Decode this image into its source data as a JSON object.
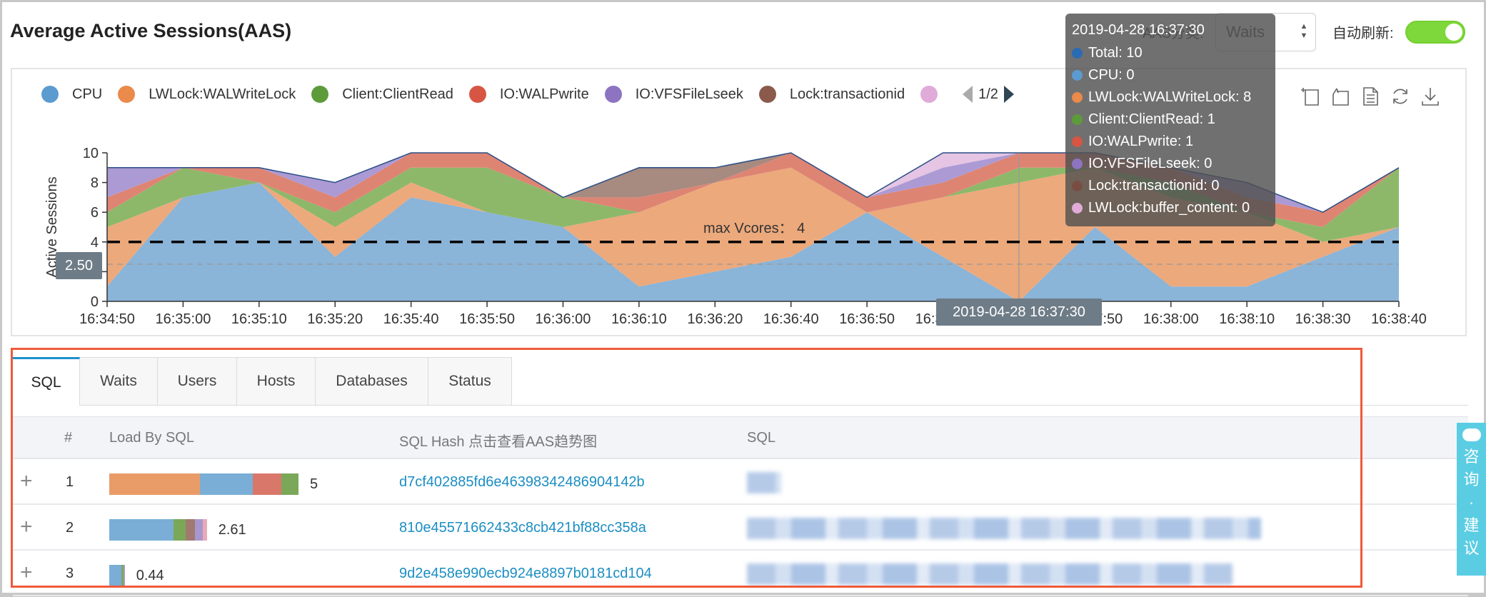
{
  "header": {
    "title": "Average Active Sessions(AAS)",
    "dimension_label": "AAS分类:",
    "dimension_select": "Waits",
    "auto_refresh_label": "自动刷新:",
    "auto_refresh_on": true
  },
  "legend": {
    "page": "1/2",
    "items": [
      {
        "label": "CPU",
        "color": "#5b9bd0"
      },
      {
        "label": "LWLock:WALWriteLock",
        "color": "#ea8a4b"
      },
      {
        "label": "Client:ClientRead",
        "color": "#5d9b3a"
      },
      {
        "label": "IO:WALPwrite",
        "color": "#d65643"
      },
      {
        "label": "IO:VFSFileLseek",
        "color": "#8d74c1"
      },
      {
        "label": "Lock:transactionid",
        "color": "#8b5a4c"
      },
      {
        "label": "",
        "color": "#e0abd8"
      }
    ]
  },
  "toolbox": [
    "zoom-icon",
    "zoom-reset-icon",
    "data-view-icon",
    "restore-icon",
    "save-image-icon"
  ],
  "chart_data": {
    "type": "area",
    "stacked": true,
    "ylabel": "Active Sessions",
    "ylim": [
      0,
      10
    ],
    "yticks": [
      0,
      2,
      4,
      6,
      8,
      10
    ],
    "x": [
      "16:34:50",
      "16:35:00",
      "16:35:10",
      "16:35:20",
      "16:35:40",
      "16:35:50",
      "16:36:00",
      "16:36:10",
      "16:36:20",
      "16:36:40",
      "16:36:50",
      "16:37:00",
      "16:37:30",
      "16:37:50",
      "16:38:00",
      "16:38:10",
      "16:38:30",
      "16:38:40"
    ],
    "series": [
      {
        "name": "CPU",
        "color": "#8ab4d8",
        "values": [
          1,
          7,
          8,
          3,
          7,
          6,
          5,
          1,
          2,
          3,
          6,
          3,
          0,
          5,
          1,
          1,
          3,
          5
        ]
      },
      {
        "name": "LWLock:WALWriteLock",
        "color": "#eca97c",
        "values": [
          4,
          0,
          0,
          2,
          1,
          0,
          0,
          5,
          6,
          6,
          0,
          4,
          8,
          4,
          6,
          5,
          1,
          0
        ]
      },
      {
        "name": "Client:ClientRead",
        "color": "#8db86a",
        "values": [
          1,
          2,
          0,
          1,
          1,
          3,
          2,
          0,
          0,
          0,
          0,
          0,
          1,
          0,
          1,
          0,
          1,
          4
        ]
      },
      {
        "name": "IO:WALPwrite",
        "color": "#de8473",
        "values": [
          1,
          0,
          1,
          1,
          1,
          1,
          0,
          1,
          0,
          1,
          1,
          1,
          1,
          1,
          1,
          1,
          1,
          0
        ]
      },
      {
        "name": "IO:VFSFileLseek",
        "color": "#ac9ad4",
        "values": [
          2,
          0,
          0,
          1,
          0,
          0,
          0,
          0,
          0,
          0,
          0,
          1,
          0,
          0,
          0,
          1,
          0,
          0
        ]
      },
      {
        "name": "Lock:transactionid",
        "color": "#a78a80",
        "values": [
          0,
          0,
          0,
          0,
          0,
          0,
          0,
          2,
          1,
          0,
          0,
          0,
          0,
          0,
          0,
          0,
          0,
          0
        ]
      },
      {
        "name": "LWLock:buffer_content",
        "color": "#e5c4e4",
        "values": [
          0,
          0,
          0,
          0,
          0,
          0,
          0,
          0,
          0,
          0,
          0,
          1,
          0,
          0,
          0,
          0,
          0,
          0
        ]
      }
    ],
    "total_line_color": "#2a4f85",
    "mark_line": {
      "value": 4,
      "label": "max Vcores： 4"
    },
    "crosshair": {
      "x": "16:37:30",
      "y": 2.5,
      "y_label": "2.50",
      "x_label": "2019-04-28 16:37:30"
    }
  },
  "tooltip": {
    "title": "2019-04-28 16:37:30",
    "rows": [
      {
        "label": "Total: 10",
        "color": "#2a6bb3"
      },
      {
        "label": "CPU: 0",
        "color": "#5b9bd0"
      },
      {
        "label": "LWLock:WALWriteLock: 8",
        "color": "#ea8a4b"
      },
      {
        "label": "Client:ClientRead: 1",
        "color": "#5d9b3a"
      },
      {
        "label": "IO:WALPwrite: 1",
        "color": "#d65643"
      },
      {
        "label": "IO:VFSFileLseek: 0",
        "color": "#8d74c1"
      },
      {
        "label": "Lock:transactionid: 0",
        "color": "#7a4d42"
      },
      {
        "label": "LWLock:buffer_content: 0",
        "color": "#e0abd8"
      }
    ]
  },
  "tabs": [
    {
      "label": "SQL",
      "active": true
    },
    {
      "label": "Waits"
    },
    {
      "label": "Users"
    },
    {
      "label": "Hosts"
    },
    {
      "label": "Databases"
    },
    {
      "label": "Status"
    }
  ],
  "table": {
    "headers": {
      "index": "#",
      "load": "Load By SQL",
      "hash": "SQL Hash 点击查看AAS趋势图",
      "sql": "SQL"
    },
    "rows": [
      {
        "index": "1",
        "load": "5",
        "hash": "d7cf402885fd6e46398342486904142b",
        "sql_blurred": true,
        "segments": [
          {
            "color": "#e99c68",
            "value": 2.4
          },
          {
            "color": "#7aaed6",
            "value": 1.4
          },
          {
            "color": "#d9776a",
            "value": 0.75
          },
          {
            "color": "#7ba858",
            "value": 0.45
          }
        ]
      },
      {
        "index": "2",
        "load": "2.61",
        "hash": "810e45571662433c8cb421bf88cc358a",
        "sql_blurred": true,
        "segments": [
          {
            "color": "#7aaed6",
            "value": 1.7
          },
          {
            "color": "#7ba858",
            "value": 0.32
          },
          {
            "color": "#a07a70",
            "value": 0.24
          },
          {
            "color": "#a897cf",
            "value": 0.22
          },
          {
            "color": "#e8a9b8",
            "value": 0.1
          }
        ]
      },
      {
        "index": "3",
        "load": "0.44",
        "hash": "9d2e458e990ecb924e8897b0181cd104",
        "sql_blurred": true,
        "segments": [
          {
            "color": "#7aaed6",
            "value": 0.33
          },
          {
            "color": "#7ba858",
            "value": 0.05
          },
          {
            "color": "#a897cf",
            "value": 0.03
          }
        ]
      }
    ]
  },
  "side_button": {
    "chars": [
      "咨",
      "询",
      "·",
      "建",
      "议"
    ]
  }
}
